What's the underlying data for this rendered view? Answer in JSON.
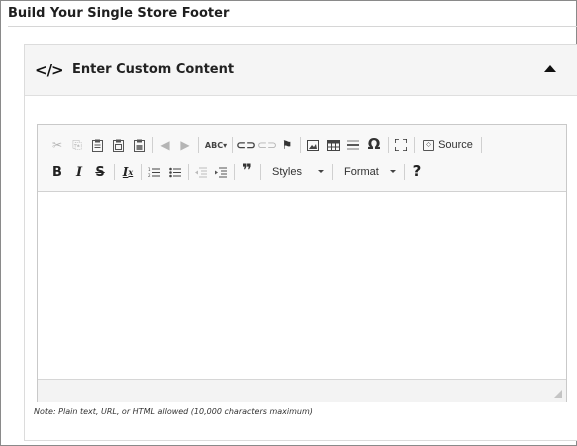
{
  "page": {
    "title": "Build Your Single Store Footer"
  },
  "panel": {
    "icon": "code-icon",
    "icon_glyph": "</>",
    "title": "Enter Custom Content",
    "collapse_icon": "caret-up-icon"
  },
  "editor": {
    "toolbar_row1": [
      {
        "name": "cut-icon",
        "glyph": "✂"
      },
      {
        "name": "copy-icon",
        "glyph": "⎘"
      },
      {
        "name": "paste-icon",
        "glyph": "📋"
      },
      {
        "name": "paste-text-icon",
        "glyph": "📋"
      },
      {
        "name": "paste-word-icon",
        "glyph": "📋"
      },
      {
        "name": "undo-icon",
        "glyph": "↶"
      },
      {
        "name": "redo-icon",
        "glyph": "↷"
      },
      {
        "name": "spellcheck-icon",
        "glyph": "ABC"
      },
      {
        "name": "link-icon",
        "glyph": "∞"
      },
      {
        "name": "unlink-icon",
        "glyph": "⌫"
      },
      {
        "name": "anchor-flag-icon",
        "glyph": "⚑"
      },
      {
        "name": "image-icon",
        "glyph": "▣"
      },
      {
        "name": "table-icon",
        "glyph": "▦"
      },
      {
        "name": "horizontal-line-icon",
        "glyph": "≡"
      },
      {
        "name": "special-char-icon",
        "glyph": "Ω"
      },
      {
        "name": "maximize-icon",
        "glyph": "⤢"
      }
    ],
    "source_label": "Source",
    "bold_label": "B",
    "italic_label": "I",
    "strike_label": "S",
    "clear_format_label": "Ix",
    "styles_label": "Styles",
    "format_label": "Format",
    "help_label": "?"
  },
  "note": "Note: Plain text, URL, or HTML allowed (10,000 characters maximum)"
}
